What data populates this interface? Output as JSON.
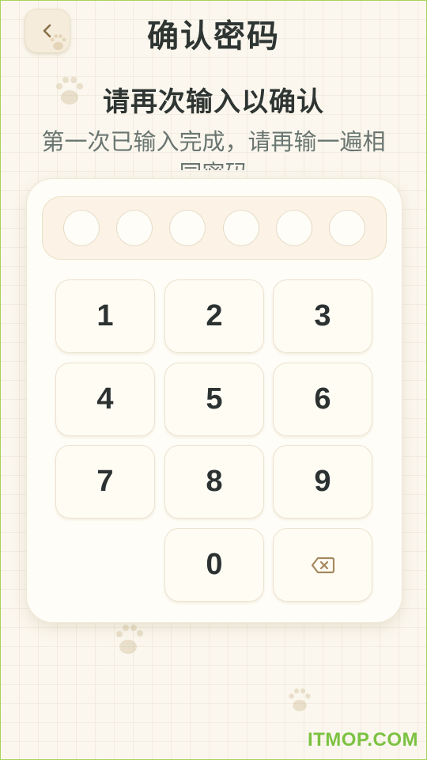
{
  "header": {
    "back_icon": "chevron-left-icon",
    "title": "确认密码"
  },
  "prompt": {
    "subtitle": "请再次输入以确认",
    "description": "第一次已输入完成，请再输一遍相",
    "description_tail": "同密码"
  },
  "pin": {
    "length": 6,
    "filled": 0
  },
  "keypad": {
    "keys": [
      "1",
      "2",
      "3",
      "4",
      "5",
      "6",
      "7",
      "8",
      "9",
      "0"
    ],
    "delete_icon": "backspace-icon"
  },
  "watermark": "ITMOP.COM",
  "colors": {
    "accent_brown": "#a4885e",
    "text_dark": "#2e3532",
    "text_muted": "#6a7671",
    "watermark_green": "#7cc242"
  }
}
